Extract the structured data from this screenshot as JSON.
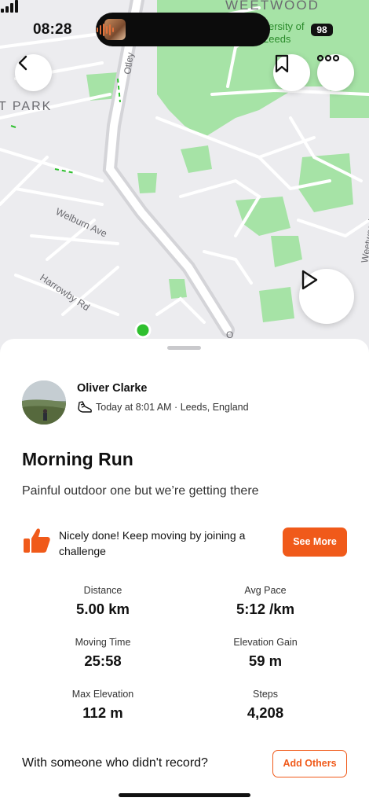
{
  "status_bar": {
    "time": "08:28",
    "battery": "98"
  },
  "map": {
    "labels": {
      "weetwood_top": "WEETWOOD",
      "university": "ersity of",
      "leeds": "Leeds",
      "park": "T PARK",
      "otley": "Otley",
      "welburn": "Welburn Ave",
      "harrowby": "Harrowby Rd",
      "weetwood_side": "Weetwood",
      "road_o": "O"
    },
    "colors": {
      "background": "#ececef",
      "green": "#a6e3a6",
      "road": "#ffffff",
      "main_road": "#d4d4d8",
      "route": "#2fc02f"
    }
  },
  "activity": {
    "athlete_name": "Oliver Clarke",
    "meta": "Today at 8:01 AM · Leeds, England",
    "title": "Morning Run",
    "description": "Painful outdoor one but we’re getting there"
  },
  "promo": {
    "text": "Nicely done! Keep moving by joining a challenge",
    "button_label": "See More"
  },
  "stats": [
    {
      "label": "Distance",
      "value": "5.00 km"
    },
    {
      "label": "Avg Pace",
      "value": "5:12 /km"
    },
    {
      "label": "Moving Time",
      "value": "25:58"
    },
    {
      "label": "Elevation Gain",
      "value": "59 m"
    },
    {
      "label": "Max Elevation",
      "value": "112 m"
    },
    {
      "label": "Steps",
      "value": "4,208"
    }
  ],
  "others": {
    "prompt": "With someone who didn't record?",
    "button_label": "Add Others"
  },
  "icons": {
    "back": "chevron-left-icon",
    "bookmark": "bookmark-icon",
    "more": "more-dots-icon",
    "play": "play-icon",
    "shoe": "shoe-icon",
    "thumbs_up": "thumbs-up-icon"
  },
  "accent_color": "#f05a1a"
}
